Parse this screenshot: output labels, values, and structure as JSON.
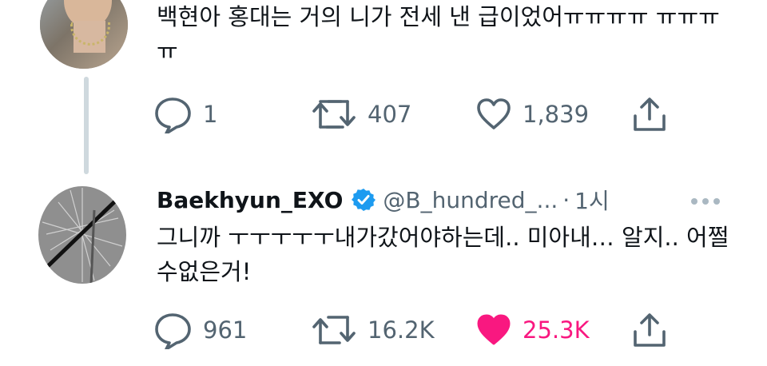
{
  "tweet1": {
    "text": "백현아 홍대는 거의 니가 전세 낸 급이었어ㅠㅠㅠㅠ ㅠㅠㅠㅠ",
    "replies": "1",
    "retweets": "407",
    "likes": "1,839"
  },
  "tweet2": {
    "display_name": "Baekhyun_EXO",
    "handle": "@B_hundred_...",
    "separator": "·",
    "time": "1시",
    "text": "그니까 ㅜㅜㅜㅜㅜ내가갔어야하는데.. 미아내… 알지.. 어쩔수없은거!",
    "replies": "961",
    "retweets": "16.2K",
    "likes": "25.3K"
  },
  "colors": {
    "text": "#0f1419",
    "secondary": "#536471",
    "like_active": "#f91880",
    "verified": "#1d9bf0",
    "thread_line": "#cfd9de"
  },
  "icons": [
    "reply-icon",
    "retweet-icon",
    "like-icon",
    "share-icon",
    "verified-badge-icon",
    "more-icon"
  ]
}
